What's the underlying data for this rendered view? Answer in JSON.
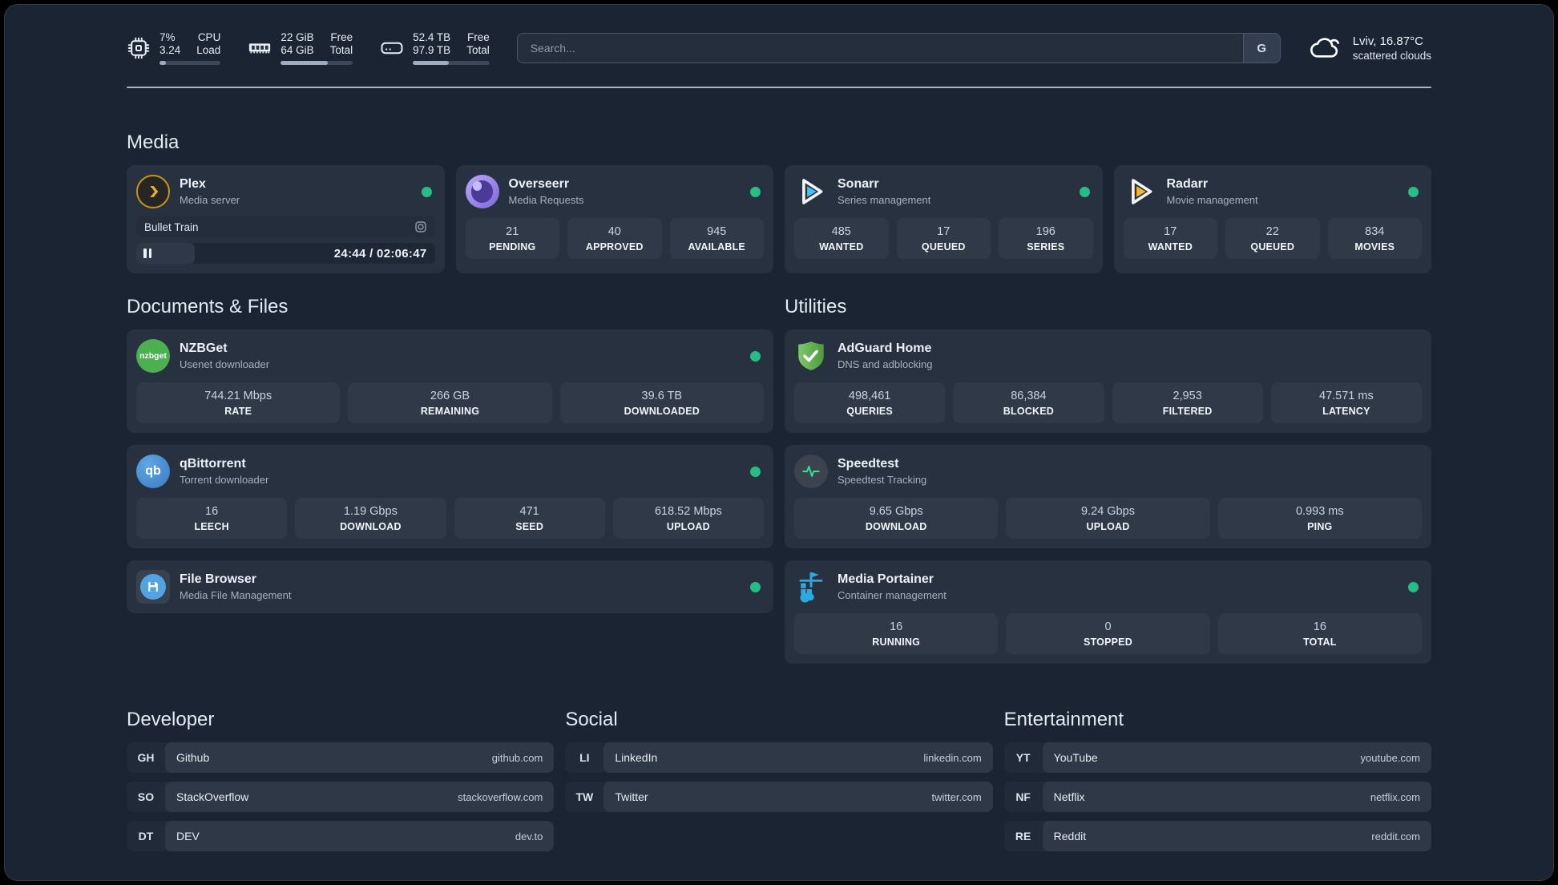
{
  "colors": {
    "status_online": "#26BD87",
    "accent_plex": "#EBAF1C",
    "accent_sonarr": "#3CC5F1",
    "accent_radarr": "#F9B52B",
    "accent_nzbget": "#4CAF50",
    "accent_qbittorrent": "#4B93DB",
    "accent_adguard": "#67B349",
    "accent_speedtest": "#3DDC97",
    "accent_portainer": "#29ABE2"
  },
  "header": {
    "cpu": {
      "value_line1": "7%",
      "value_line2": "3.24",
      "label_line1": "CPU",
      "label_line2": "Load",
      "progress_percent": 10
    },
    "memory": {
      "value_line1": "22 GiB",
      "value_line2": "64 GiB",
      "label_line1": "Free",
      "label_line2": "Total",
      "progress_percent": 65
    },
    "disk": {
      "value_line1": "52.4 TB",
      "value_line2": "97.9 TB",
      "label_line1": "Free",
      "label_line2": "Total",
      "progress_percent": 47
    },
    "search": {
      "placeholder": "Search...",
      "engine_button": "G"
    },
    "weather": {
      "line1": "Lviv, 16.87°C",
      "line2": "scattered clouds"
    }
  },
  "sections": {
    "media": {
      "title": "Media",
      "plex": {
        "name": "Plex",
        "description": "Media server",
        "status": "online",
        "now_playing": {
          "title": "Bullet Train",
          "time_display": "24:44 / 02:06:47",
          "progress_percent": 19.5
        }
      },
      "overseerr": {
        "name": "Overseerr",
        "description": "Media Requests",
        "status": "online",
        "stats": [
          {
            "value": "21",
            "label": "PENDING"
          },
          {
            "value": "40",
            "label": "APPROVED"
          },
          {
            "value": "945",
            "label": "AVAILABLE"
          }
        ]
      },
      "sonarr": {
        "name": "Sonarr",
        "description": "Series management",
        "status": "online",
        "stats": [
          {
            "value": "485",
            "label": "WANTED"
          },
          {
            "value": "17",
            "label": "QUEUED"
          },
          {
            "value": "196",
            "label": "SERIES"
          }
        ]
      },
      "radarr": {
        "name": "Radarr",
        "description": "Movie management",
        "status": "online",
        "stats": [
          {
            "value": "17",
            "label": "WANTED"
          },
          {
            "value": "22",
            "label": "QUEUED"
          },
          {
            "value": "834",
            "label": "MOVIES"
          }
        ]
      }
    },
    "documents": {
      "title": "Documents & Files",
      "nzbget": {
        "name": "NZBGet",
        "description": "Usenet downloader",
        "status": "online",
        "icon_text": "nzbget",
        "stats": [
          {
            "value": "744.21 Mbps",
            "label": "RATE"
          },
          {
            "value": "266 GB",
            "label": "REMAINING"
          },
          {
            "value": "39.6 TB",
            "label": "DOWNLOADED"
          }
        ]
      },
      "qbittorrent": {
        "name": "qBittorrent",
        "description": "Torrent downloader",
        "status": "online",
        "icon_text": "qb",
        "stats": [
          {
            "value": "16",
            "label": "LEECH"
          },
          {
            "value": "1.19 Gbps",
            "label": "DOWNLOAD"
          },
          {
            "value": "471",
            "label": "SEED"
          },
          {
            "value": "618.52 Mbps",
            "label": "UPLOAD"
          }
        ]
      },
      "filebrowser": {
        "name": "File Browser",
        "description": "Media File Management",
        "status": "online"
      }
    },
    "utilities": {
      "title": "Utilities",
      "adguard": {
        "name": "AdGuard Home",
        "description": "DNS and adblocking",
        "stats": [
          {
            "value": "498,461",
            "label": "QUERIES"
          },
          {
            "value": "86,384",
            "label": "BLOCKED"
          },
          {
            "value": "2,953",
            "label": "FILTERED"
          },
          {
            "value": "47.571 ms",
            "label": "LATENCY"
          }
        ]
      },
      "speedtest": {
        "name": "Speedtest",
        "description": "Speedtest Tracking",
        "stats": [
          {
            "value": "9.65 Gbps",
            "label": "DOWNLOAD"
          },
          {
            "value": "9.24 Gbps",
            "label": "UPLOAD"
          },
          {
            "value": "0.993 ms",
            "label": "PING"
          }
        ]
      },
      "portainer": {
        "name": "Media Portainer",
        "description": "Container management",
        "status": "online",
        "stats": [
          {
            "value": "16",
            "label": "RUNNING"
          },
          {
            "value": "0",
            "label": "STOPPED"
          },
          {
            "value": "16",
            "label": "TOTAL"
          }
        ]
      }
    },
    "developer": {
      "title": "Developer",
      "links": [
        {
          "tag": "GH",
          "name": "Github",
          "url": "github.com"
        },
        {
          "tag": "SO",
          "name": "StackOverflow",
          "url": "stackoverflow.com"
        },
        {
          "tag": "DT",
          "name": "DEV",
          "url": "dev.to"
        }
      ]
    },
    "social": {
      "title": "Social",
      "links": [
        {
          "tag": "LI",
          "name": "LinkedIn",
          "url": "linkedin.com"
        },
        {
          "tag": "TW",
          "name": "Twitter",
          "url": "twitter.com"
        }
      ]
    },
    "entertainment": {
      "title": "Entertainment",
      "links": [
        {
          "tag": "YT",
          "name": "YouTube",
          "url": "youtube.com"
        },
        {
          "tag": "NF",
          "name": "Netflix",
          "url": "netflix.com"
        },
        {
          "tag": "RE",
          "name": "Reddit",
          "url": "reddit.com"
        }
      ]
    }
  }
}
